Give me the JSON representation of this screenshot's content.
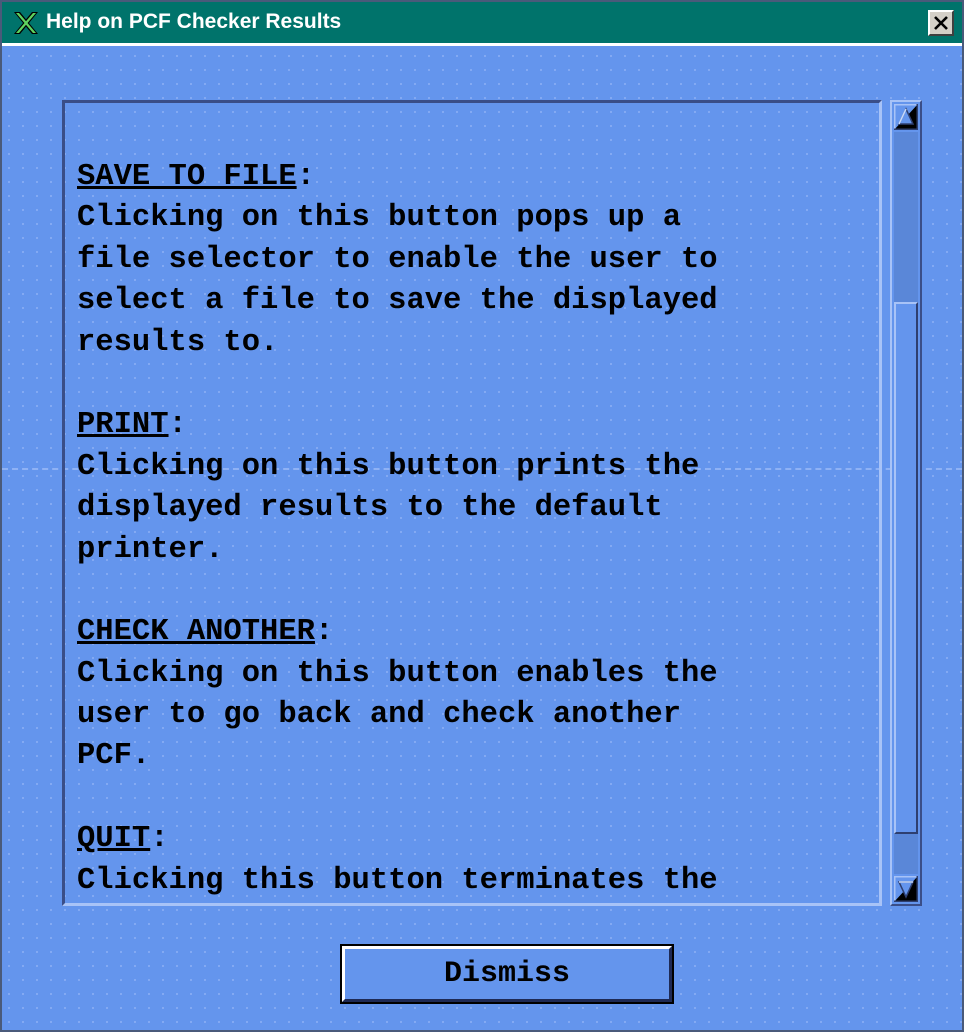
{
  "window": {
    "title": "Help on PCF Checker Results",
    "close_symbol": "x",
    "icon": "x-window-icon"
  },
  "help_text": {
    "sections": [
      {
        "heading": "SAVE TO FILE",
        "heading_suffix": ":",
        "lines": [
          "Clicking on this button pops up a",
          "file selector to enable the user to",
          "select a file to save the displayed",
          "results to."
        ]
      },
      {
        "heading": "PRINT",
        "heading_suffix": ":",
        "lines": [
          "Clicking on this button prints the",
          "displayed results to the default",
          "printer."
        ]
      },
      {
        "heading": "CHECK ANOTHER",
        "heading_suffix": ":",
        "lines": [
          "Clicking on this button enables the",
          "user to go back and check another",
          "PCF."
        ]
      },
      {
        "heading": "QUIT",
        "heading_suffix": ":",
        "lines": [
          "Clicking this button terminates the"
        ]
      }
    ]
  },
  "buttons": {
    "dismiss_label": "Dismiss"
  },
  "colors": {
    "background": "#6495ed",
    "titlebar": "#00736b",
    "text": "#000000"
  }
}
